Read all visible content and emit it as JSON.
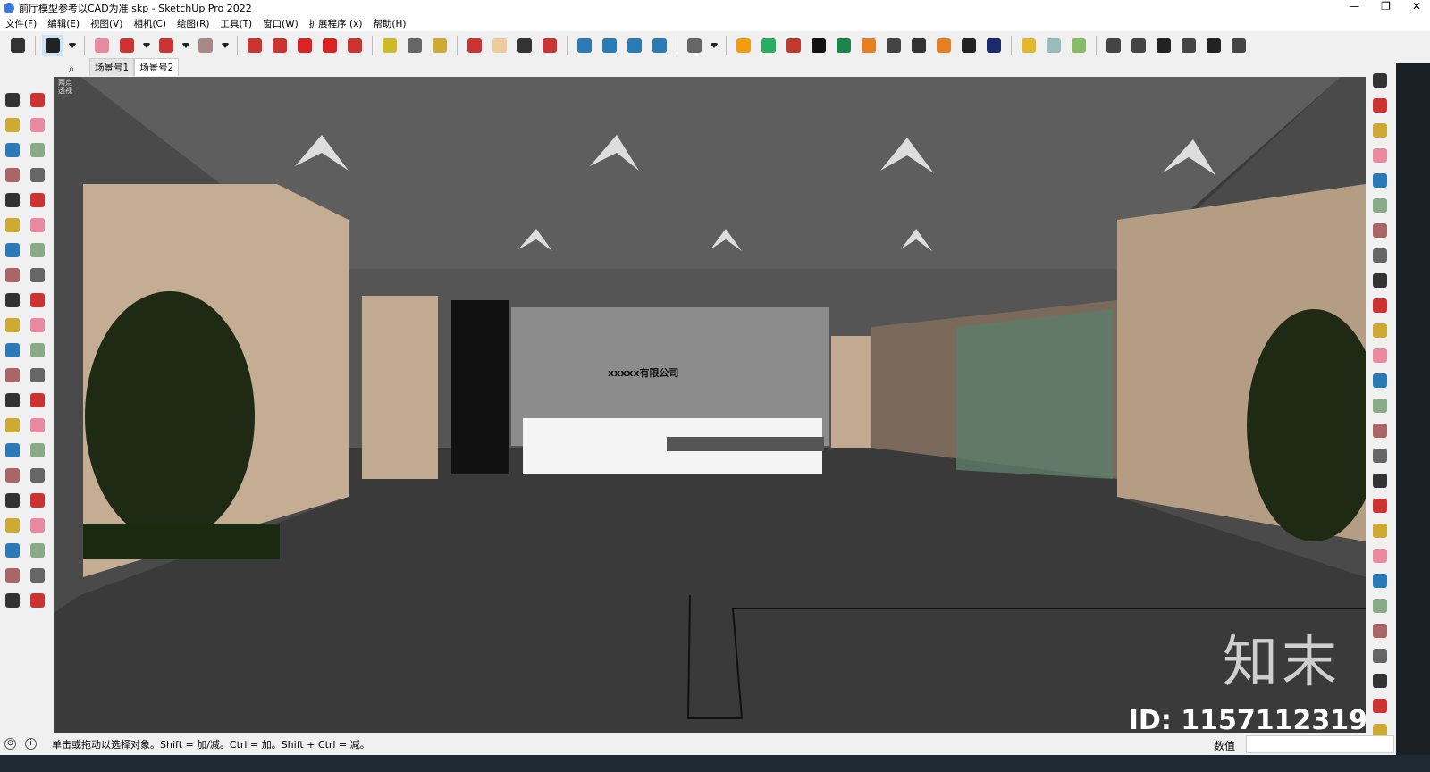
{
  "window": {
    "title": "前厅模型参考以CAD为准.skp - SketchUp Pro 2022",
    "minimize": "—",
    "maximize": "❐",
    "close": "✕"
  },
  "menu": [
    "文件(F)",
    "编辑(E)",
    "视图(V)",
    "相机(C)",
    "绘图(R)",
    "工具(T)",
    "窗口(W)",
    "扩展程序 (x)",
    "帮助(H)"
  ],
  "toolbar_icons": [
    {
      "name": "zoom-icon",
      "color": "#333"
    },
    {
      "sep": true
    },
    {
      "name": "select-icon",
      "color": "#222",
      "active": true
    },
    {
      "name": "dropdown-icon",
      "color": "#222"
    },
    {
      "sep": true
    },
    {
      "name": "eraser-icon",
      "color": "#e88aa0"
    },
    {
      "name": "pencil-icon",
      "color": "#c33"
    },
    {
      "name": "dropdown-icon",
      "color": "#222"
    },
    {
      "name": "arc-icon",
      "color": "#c33"
    },
    {
      "name": "dropdown-icon",
      "color": "#222"
    },
    {
      "name": "rectangle-icon",
      "color": "#a88"
    },
    {
      "name": "dropdown-icon",
      "color": "#222"
    },
    {
      "sep": true
    },
    {
      "name": "push-pull-icon",
      "color": "#c33"
    },
    {
      "name": "follow-me-icon",
      "color": "#c33"
    },
    {
      "name": "move-icon",
      "color": "#d22"
    },
    {
      "name": "rotate-icon",
      "color": "#d22"
    },
    {
      "name": "scale-icon",
      "color": "#c33"
    },
    {
      "sep": true
    },
    {
      "name": "tape-measure-icon",
      "color": "#cb2"
    },
    {
      "name": "text-icon",
      "color": "#666"
    },
    {
      "name": "paint-bucket-icon",
      "color": "#ca3"
    },
    {
      "sep": true
    },
    {
      "name": "orbit-icon",
      "color": "#c33"
    },
    {
      "name": "pan-icon",
      "color": "#ec9"
    },
    {
      "name": "zoom-window-icon",
      "color": "#333"
    },
    {
      "name": "zoom-extents-icon",
      "color": "#c33"
    },
    {
      "sep": true
    },
    {
      "name": "warehouse-icon",
      "color": "#2a7ab5"
    },
    {
      "name": "extension-icon",
      "color": "#2a7ab5"
    },
    {
      "name": "layers-icon",
      "color": "#2a7ab5"
    },
    {
      "name": "send-icon",
      "color": "#2a7ab5"
    },
    {
      "sep": true
    },
    {
      "name": "user-icon",
      "color": "#666"
    },
    {
      "name": "dropdown-icon",
      "color": "#222"
    },
    {
      "sep": true
    },
    {
      "name": "plugin-e-icon",
      "color": "#f39c12"
    },
    {
      "name": "refresh-icon",
      "color": "#27ae60"
    },
    {
      "name": "export-icon",
      "color": "#c0392b"
    },
    {
      "name": "add-icon",
      "color": "#111"
    },
    {
      "name": "tree-icon",
      "color": "#1e8449"
    },
    {
      "name": "chart-icon",
      "color": "#e67e22"
    },
    {
      "name": "checker-icon",
      "color": "#444"
    },
    {
      "name": "cloud-icon",
      "color": "#333"
    },
    {
      "name": "gear-icon",
      "color": "#e67e22"
    },
    {
      "name": "mail-icon",
      "color": "#222"
    },
    {
      "name": "info-icon",
      "color": "#1a2a6c"
    },
    {
      "sep": true
    },
    {
      "name": "cube-icon",
      "color": "#e5b72c"
    },
    {
      "name": "cube-view-icon",
      "color": "#9bb"
    },
    {
      "name": "cube-iso-icon",
      "color": "#8b6"
    },
    {
      "sep": true
    },
    {
      "name": "view-iso-icon",
      "color": "#444"
    },
    {
      "name": "view-front-icon",
      "color": "#444"
    },
    {
      "name": "home-icon",
      "color": "#222"
    },
    {
      "name": "view-back-icon",
      "color": "#444"
    },
    {
      "name": "view-side-icon",
      "color": "#222"
    },
    {
      "name": "view-top-icon",
      "color": "#444"
    }
  ],
  "left_icons": [
    "select",
    "orbit",
    "paint",
    "eraser",
    "component",
    "paint-drop",
    "line",
    "freehand",
    "rectangle",
    "rotated-rect",
    "circle",
    "polygon",
    "arc",
    "pie",
    "arc3",
    "arc2",
    "move",
    "push-pull",
    "rotate",
    "follow-me",
    "scale",
    "offset",
    "tape-measure",
    "dimension",
    "protractor",
    "text",
    "axes",
    "3d-text",
    "orbit2",
    "pan",
    "zoom",
    "zoom-window",
    "zoom-extents",
    "prev-view",
    "walk",
    "look-around",
    "footprints",
    "section",
    "warehouse",
    "extension",
    "layers",
    "send"
  ],
  "right_icons": [
    "r1",
    "r2",
    "r3",
    "r4",
    "r5",
    "r6",
    "r7",
    "r8",
    "r9",
    "r10",
    "r11",
    "r12",
    "r13",
    "r14",
    "r15",
    "r16",
    "r17",
    "r18",
    "r19",
    "r20",
    "r21",
    "r22",
    "r23",
    "r24",
    "r25",
    "r26",
    "r27"
  ],
  "scene_tabs": {
    "search": "⌕",
    "tabs": [
      {
        "label": "场景号1",
        "active": false
      },
      {
        "label": "场景号2",
        "active": true
      }
    ]
  },
  "viewport": {
    "camera_label": "两点透视",
    "sign_text": "xxxxx有限公司",
    "watermark": "知末",
    "watermark_id": "ID: 1157112319"
  },
  "status": {
    "text": "单击或拖动以选择对象。Shift = 加/减。Ctrl = 加。Shift + Ctrl = 减。",
    "measure_label": "数值",
    "measure_value": ""
  }
}
